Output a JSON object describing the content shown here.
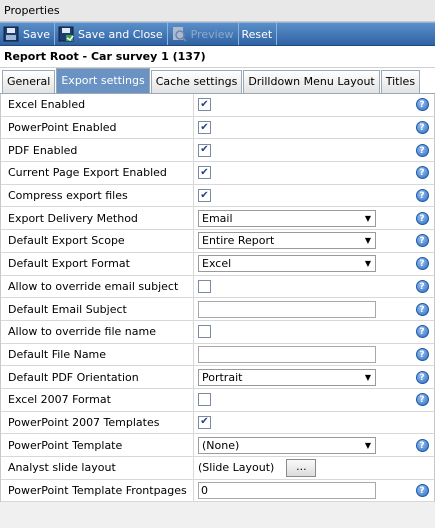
{
  "window": {
    "title": "Properties"
  },
  "toolbar": {
    "save": "Save",
    "save_close": "Save and Close",
    "preview": "Preview",
    "reset": "Reset"
  },
  "report": {
    "title": "Report Root - Car survey 1 (137)"
  },
  "tabs": [
    "General",
    "Export settings",
    "Cache settings",
    "Drilldown Menu Layout",
    "Titles"
  ],
  "rows": [
    {
      "label": "Excel Enabled",
      "type": "checkbox",
      "checked": true,
      "help": true
    },
    {
      "label": "PowerPoint Enabled",
      "type": "checkbox",
      "checked": true,
      "help": true
    },
    {
      "label": "PDF Enabled",
      "type": "checkbox",
      "checked": true,
      "help": true
    },
    {
      "label": "Current Page Export Enabled",
      "type": "checkbox",
      "checked": true,
      "help": true
    },
    {
      "label": "Compress export files",
      "type": "checkbox",
      "checked": true,
      "help": true
    },
    {
      "label": "Export Delivery Method",
      "type": "select",
      "value": "Email",
      "help": true
    },
    {
      "label": "Default Export Scope",
      "type": "select",
      "value": "Entire Report",
      "help": true
    },
    {
      "label": "Default Export Format",
      "type": "select",
      "value": "Excel",
      "help": true
    },
    {
      "label": "Allow to override email subject",
      "type": "checkbox",
      "checked": false,
      "help": true
    },
    {
      "label": "Default Email Subject",
      "type": "text",
      "value": "",
      "help": true
    },
    {
      "label": "Allow to override file name",
      "type": "checkbox",
      "checked": false,
      "help": true
    },
    {
      "label": "Default File Name",
      "type": "text",
      "value": "",
      "help": true
    },
    {
      "label": "Default PDF Orientation",
      "type": "select",
      "value": "Portrait",
      "help": true
    },
    {
      "label": "Excel 2007 Format",
      "type": "checkbox",
      "checked": false,
      "help": true
    },
    {
      "label": "PowerPoint 2007 Templates",
      "type": "checkbox",
      "checked": true,
      "help": false
    },
    {
      "label": "PowerPoint Template",
      "type": "select",
      "value": "(None)",
      "help": true
    },
    {
      "label": "Analyst slide layout",
      "type": "static",
      "value": "(Slide Layout)",
      "button": "...",
      "help": false
    },
    {
      "label": "PowerPoint Template Frontpages",
      "type": "text",
      "value": "0",
      "help": true
    }
  ],
  "colors": {
    "toolbar": "#3a6fb0",
    "active_tab": "#6a93c3",
    "help": "#2a6ac0"
  }
}
